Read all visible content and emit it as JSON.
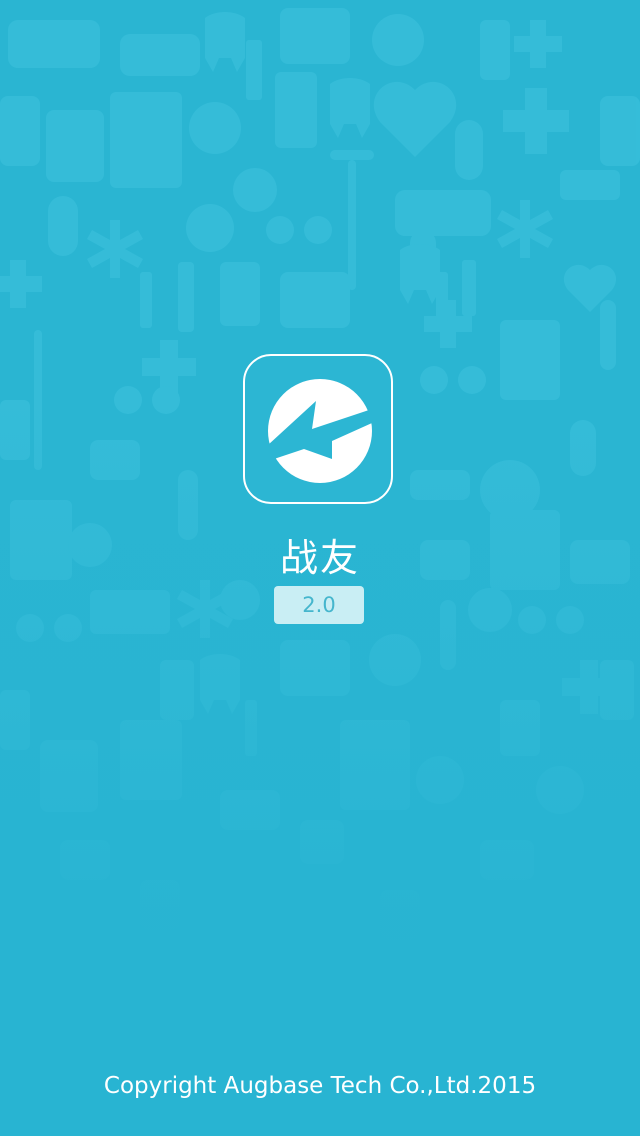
{
  "app": {
    "name": "战友",
    "version": "2.0",
    "logo_icon": "lightning-logo-icon"
  },
  "footer": {
    "copyright": "Copyright Augbase Tech Co.,Ltd.2015"
  },
  "background": {
    "pattern": "medical-icons-pattern",
    "colors": {
      "base": "#2ab5d2",
      "pattern": "#3cc0dc"
    }
  }
}
